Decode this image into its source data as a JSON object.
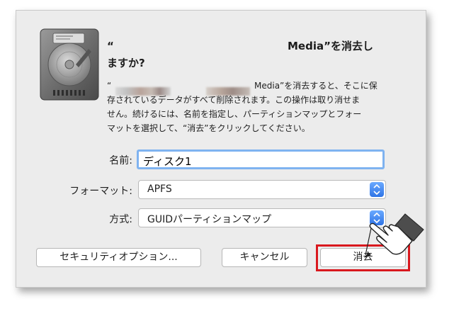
{
  "dialog": {
    "title_quote": "“",
    "title_line1": "Media”を消去し",
    "title_line2": "ますか?",
    "desc_line1_prefix": "“",
    "desc_line1_suffix": "Media”を消去すると、そこに保",
    "desc_line2": "存されているデータがすべて削除されます。この操作は取り消せま",
    "desc_line3": "せん。続けるには、名前を指定し、パーティションマップとフォー",
    "desc_line4": "マットを選択して、“消去”をクリックしてください。"
  },
  "form": {
    "name_label": "名前:",
    "name_value": "ディスク1",
    "format_label": "フォーマット:",
    "format_value": "APFS",
    "scheme_label": "方式:",
    "scheme_value": "GUIDパーティションマップ"
  },
  "buttons": {
    "security": "セキュリティオプション...",
    "cancel": "キャンセル",
    "erase": "消去"
  },
  "colors": {
    "highlight_border": "#d9181e",
    "focus_ring": "#7fb3f0",
    "select_accent": "#2f74e6"
  }
}
